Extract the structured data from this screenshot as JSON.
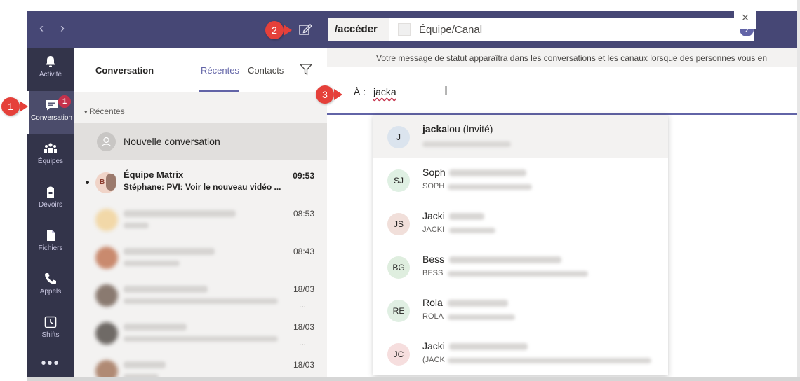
{
  "command_bar": {
    "command": "/accéder",
    "search_value": "Équipe/Canal"
  },
  "rail": {
    "items": [
      {
        "label": "Activité"
      },
      {
        "label": "Conversation",
        "badge": "1"
      },
      {
        "label": "Équipes"
      },
      {
        "label": "Devoirs"
      },
      {
        "label": "Fichiers"
      },
      {
        "label": "Appels"
      },
      {
        "label": "Shifts"
      }
    ],
    "more": "•••"
  },
  "list": {
    "title": "Conversation",
    "tabs": [
      "Récentes",
      "Contacts"
    ],
    "section": "Récentes",
    "new_conversation": "Nouvelle conversation",
    "rows": [
      {
        "name": "Équipe Matrix",
        "preview": "Stéphane: PVI: Voir le nouveau vidéo ...",
        "time": "09:53",
        "avatar_initial": "B"
      },
      {
        "time": "08:53"
      },
      {
        "time": "08:43"
      },
      {
        "time": "18/03"
      },
      {
        "time": "18/03"
      },
      {
        "time": "18/03"
      }
    ]
  },
  "main": {
    "status_banner": "Votre message de statut apparaîtra dans les conversations et les canaux lorsque des personnes vous en",
    "to_label": "À :",
    "to_value": "jacka",
    "suggestions": [
      {
        "initials": "J",
        "name": "jackalou (Invité)",
        "color": "#dbe4ee"
      },
      {
        "initials": "SJ",
        "name": "Soph",
        "sub": "SOPH",
        "color": "#dff0e3"
      },
      {
        "initials": "JS",
        "name": "Jacki",
        "sub": "JACKI",
        "color": "#f1dfda"
      },
      {
        "initials": "BG",
        "name": "Bess",
        "sub": "BESS",
        "color": "#dfeedf"
      },
      {
        "initials": "RE",
        "name": "Rola",
        "sub": "ROLA",
        "color": "#e0efe3"
      },
      {
        "initials": "JC",
        "name": "Jacki",
        "sub": "(JACK",
        "color": "#f6dede"
      }
    ]
  },
  "callouts": [
    "1",
    "2",
    "3"
  ],
  "colors": {
    "brand": "#464775",
    "rail": "#33344a",
    "accent": "#6264a7",
    "callout": "#e5403a"
  }
}
